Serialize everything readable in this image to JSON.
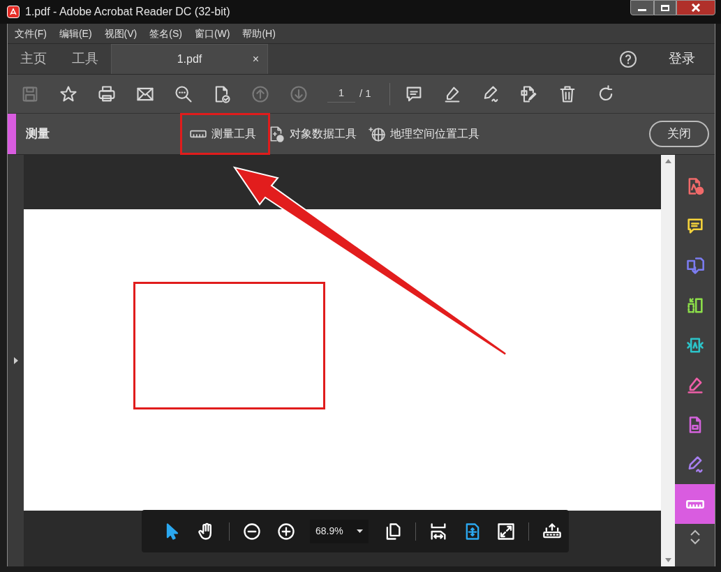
{
  "window": {
    "title": "1.pdf - Adobe Acrobat Reader DC (32-bit)"
  },
  "menu": [
    "文件(F)",
    "编辑(E)",
    "视图(V)",
    "签名(S)",
    "窗口(W)",
    "帮助(H)"
  ],
  "tabs": [
    {
      "label": "主页",
      "selected": false
    },
    {
      "label": "工具",
      "selected": false
    },
    {
      "label": "1.pdf",
      "selected": true,
      "close": "×"
    }
  ],
  "login": "登录",
  "toolbar": {
    "left": [
      {
        "kind": "save",
        "disabled": true
      },
      {
        "kind": "star",
        "disabled": false
      },
      {
        "kind": "print",
        "disabled": false
      },
      {
        "kind": "mail",
        "disabled": false
      },
      {
        "kind": "search",
        "disabled": false
      },
      {
        "kind": "spell",
        "disabled": false
      },
      {
        "kind": "up",
        "disabled": true
      },
      {
        "kind": "down",
        "disabled": true
      }
    ],
    "page": "1",
    "page_total": "/ 1",
    "right": [
      {
        "kind": "comment",
        "disabled": false
      },
      {
        "kind": "highlight",
        "disabled": false
      },
      {
        "kind": "sign",
        "disabled": false
      },
      {
        "kind": "edit",
        "disabled": false
      },
      {
        "kind": "trash",
        "disabled": false
      },
      {
        "kind": "rotate",
        "disabled": false
      }
    ]
  },
  "measure_bar": {
    "title": "测量",
    "tools": [
      {
        "kind": "ruler",
        "label": "测量工具"
      },
      {
        "kind": "object",
        "label": "对象数据工具"
      },
      {
        "kind": "globe",
        "label": "地理空间位置工具"
      }
    ],
    "close": "关闭"
  },
  "right_panel": [
    {
      "kind": "create",
      "color": "#f06a6a",
      "selected": false
    },
    {
      "kind": "comment",
      "color": "#f5d33b",
      "selected": false
    },
    {
      "kind": "export",
      "color": "#7b7cf0",
      "selected": false
    },
    {
      "kind": "organize",
      "color": "#8de04a",
      "selected": false
    },
    {
      "kind": "compress",
      "color": "#2cc3c8",
      "selected": false
    },
    {
      "kind": "highlight",
      "color": "#ee5fa8",
      "selected": false
    },
    {
      "kind": "fill",
      "color": "#d463dc",
      "selected": false
    },
    {
      "kind": "sign",
      "color": "#a77ff0",
      "selected": false
    },
    {
      "kind": "ruler",
      "color": "#ffffff",
      "selected": true
    }
  ],
  "bottom_toolbar": {
    "left": [
      {
        "kind": "select",
        "selected": true
      },
      {
        "kind": "hand",
        "selected": false
      },
      {
        "kind": "sep"
      },
      {
        "kind": "zoomout",
        "selected": false
      },
      {
        "kind": "zoomin",
        "selected": false
      }
    ],
    "zoom": "68.9%",
    "right": [
      {
        "kind": "pages",
        "selected": false
      },
      {
        "kind": "sep"
      },
      {
        "kind": "fitwidth",
        "selected": false
      },
      {
        "kind": "fitpage",
        "selected": true
      },
      {
        "kind": "fullscreen",
        "selected": false
      },
      {
        "kind": "sep"
      },
      {
        "kind": "upload",
        "selected": false
      }
    ]
  }
}
